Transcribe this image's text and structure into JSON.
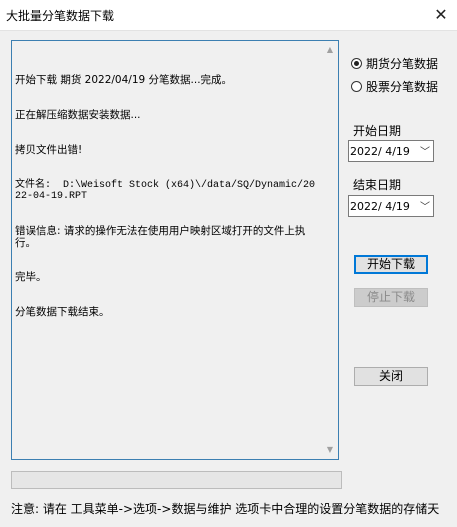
{
  "window": {
    "title": "大批量分笔数据下载",
    "close_glyph": "✕"
  },
  "log": {
    "lines": [
      "开始下载 期货 2022/04/19 分笔数据...完成。",
      "正在解压缩数据安装数据...",
      "拷贝文件出错!",
      "文件名:  D:\\Weisoft Stock (x64)\\/data/SQ/Dynamic/2022-04-19.RPT",
      "错误信息: 请求的操作无法在使用用户映射区域打开的文件上执行。",
      "完毕。",
      "分笔数据下载结束。"
    ]
  },
  "options": {
    "futures_label": "期货分笔数据",
    "stocks_label": "股票分笔数据",
    "selected": "futures"
  },
  "start_date": {
    "label": "开始日期",
    "value": "2022/ 4/19"
  },
  "end_date": {
    "label": "结束日期",
    "value": "2022/ 4/19"
  },
  "buttons": {
    "start_download": "开始下载",
    "stop_download": "停止下载",
    "close": "关闭"
  },
  "footer": {
    "note": "注意: 请在 工具菜单->选项->数据与维护 选项卡中合理的设置分笔数据的存储天"
  }
}
